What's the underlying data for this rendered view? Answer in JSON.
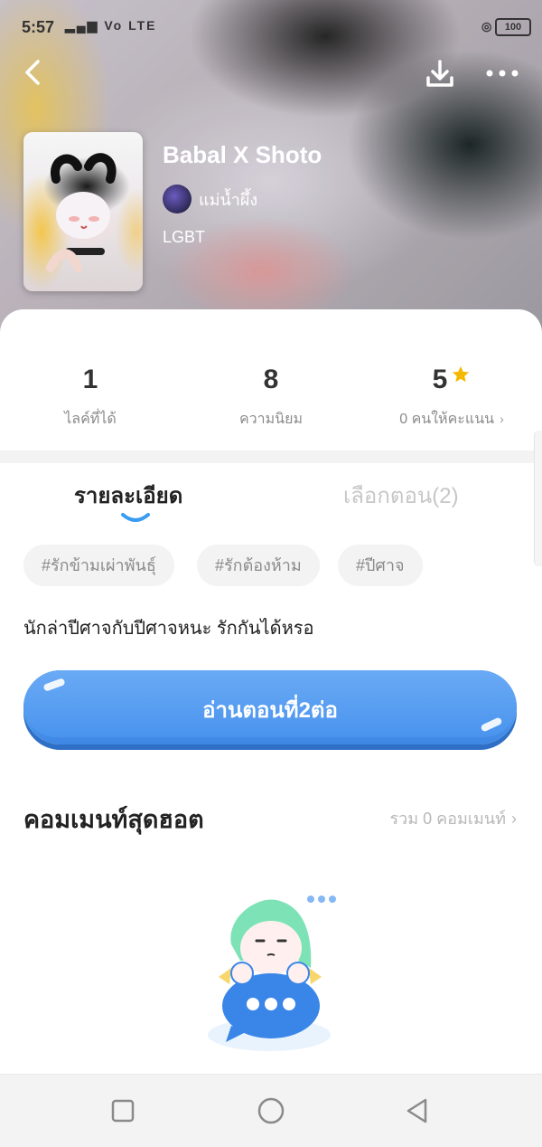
{
  "status": {
    "time": "5:57",
    "network": "Vo LTE",
    "battery": "100"
  },
  "header": {
    "title": "Babal X Shoto",
    "author": "แม่น้ำผึ้ง",
    "genre": "LGBT"
  },
  "stats": [
    {
      "value": "1",
      "label": "ไลค์ที่ได้"
    },
    {
      "value": "8",
      "label": "ความนิยม"
    },
    {
      "value": "5",
      "label": "0 คนให้คะแนน"
    }
  ],
  "tabs": {
    "detail": "รายละเอียด",
    "episodes": "เลือกตอน(2)"
  },
  "tags": [
    "#รักข้ามเผ่าพันธุ์",
    "#รักต้องห้าม",
    "#ปีศาจ"
  ],
  "description": "นักล่าปีศาจกับปีศาจหนะ  รักกันได้หรอ",
  "read_button": "อ่านตอนที่2ต่อ",
  "comments": {
    "title": "คอมเมนท์สุดฮอต",
    "count_label": "รวม 0 คอมเมนท์"
  },
  "colors": {
    "accent": "#4a94ee",
    "star": "#f5b800",
    "indicator": "#3a9cf1"
  }
}
